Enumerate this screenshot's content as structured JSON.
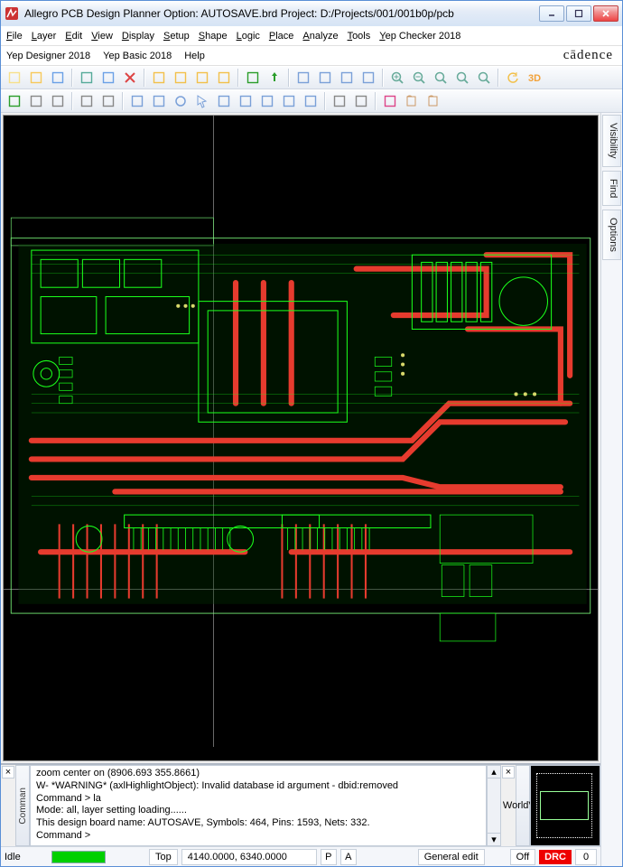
{
  "titlebar": {
    "title": "Allegro PCB Design Planner Option: AUTOSAVE.brd  Project: D:/Projects/001/001b0p/pcb"
  },
  "menus1": [
    {
      "label": "File",
      "u": "F"
    },
    {
      "label": "Layer",
      "u": "L"
    },
    {
      "label": "Edit",
      "u": "E"
    },
    {
      "label": "View",
      "u": "V"
    },
    {
      "label": "Display",
      "u": "D"
    },
    {
      "label": "Setup",
      "u": "S"
    },
    {
      "label": "Shape",
      "u": "S"
    },
    {
      "label": "Logic",
      "u": "L"
    },
    {
      "label": "Place",
      "u": "P"
    },
    {
      "label": "Analyze",
      "u": "A"
    },
    {
      "label": "Tools",
      "u": "T"
    },
    {
      "label": "Yep Checker 2018",
      "u": "Y"
    }
  ],
  "menus2": [
    {
      "label": "Yep Designer 2018",
      "u": "Y"
    },
    {
      "label": "Yep Basic 2018",
      "u": "Y"
    },
    {
      "label": "Help",
      "u": "H"
    }
  ],
  "brand": "cādence",
  "toolbar1_icons": [
    "new-file",
    "open-file",
    "save",
    "sep",
    "move-xy",
    "copy",
    "delete",
    "sep",
    "undo",
    "redo",
    "rotate-ccw",
    "rotate-cw",
    "sep",
    "measure-on",
    "pin",
    "sep",
    "grid-1",
    "grid-2",
    "grid-3",
    "grid-select",
    "sep",
    "zoom-in",
    "zoom-out",
    "zoom-fit",
    "zoom-window",
    "zoom-prev",
    "sep",
    "refresh",
    "view-3d"
  ],
  "toolbar2_icons": [
    "layer-all",
    "layer-top",
    "layer-bot",
    "sep",
    "layer-1",
    "layer-2",
    "sep",
    "shape-l",
    "shape-rect",
    "shape-circle",
    "select",
    "window",
    "save-view",
    "rect2",
    "rect3",
    "poly",
    "sep",
    "dim-h",
    "dim-angle",
    "sep",
    "snap",
    "book",
    "book2"
  ],
  "sidetabs": [
    "Visibility",
    "Find",
    "Options"
  ],
  "cmd": {
    "closebtn": "×",
    "lines": [
      "zoom center on (8906.693 355.8661)",
      "W- *WARNING* (axlHighlightObject): Invalid database id argument - dbid:removed",
      "Command > la",
      "Mode: all, layer setting loading......",
      "This design board name: AUTOSAVE, Symbols: 464, Pins: 1593, Nets: 332.",
      "Command >"
    ],
    "handle": "Comman",
    "world_handle": "WorldVie"
  },
  "status": {
    "idle": "Idle",
    "layer": "Top",
    "coords": "4140.0000, 6340.0000",
    "p": "P",
    "a": "A",
    "mode": "General edit",
    "off": "Off",
    "drc": "DRC",
    "drc_count": "0"
  },
  "icons": {
    "new-file": "#f7e08a",
    "open-file": "#f7c95a",
    "save": "#6aa0e6",
    "move-xy": "#5a9",
    "copy": "#6aa0e6",
    "delete": "#d44",
    "undo": "#f2c04a",
    "redo": "#f2c04a",
    "rotate-ccw": "#f2c04a",
    "rotate-cw": "#f2c04a",
    "measure-on": "#2a9d2a",
    "pin": "#2a9d2a",
    "grid-1": "#7aa0d8",
    "grid-2": "#7aa0d8",
    "grid-3": "#7aa0d8",
    "grid-select": "#7aa0d8",
    "zoom-in": "#6a9",
    "zoom-out": "#6a9",
    "zoom-fit": "#6a9",
    "zoom-window": "#6a9",
    "zoom-prev": "#6a9",
    "refresh": "#f2c04a",
    "view-3d": "#f2a23a",
    "layer-all": "#2a9d2a",
    "layer-top": "#888",
    "layer-bot": "#888",
    "layer-1": "#888",
    "layer-2": "#888",
    "shape-l": "#7aa0d8",
    "shape-rect": "#7aa0d8",
    "shape-circle": "#7aa0d8",
    "select": "#7aa0d8",
    "window": "#7aa0d8",
    "save-view": "#7aa0d8",
    "rect2": "#7aa0d8",
    "rect3": "#7aa0d8",
    "poly": "#7aa0d8",
    "dim-h": "#888",
    "dim-angle": "#888",
    "snap": "#d48",
    "book": "#c96",
    "book2": "#c96"
  }
}
